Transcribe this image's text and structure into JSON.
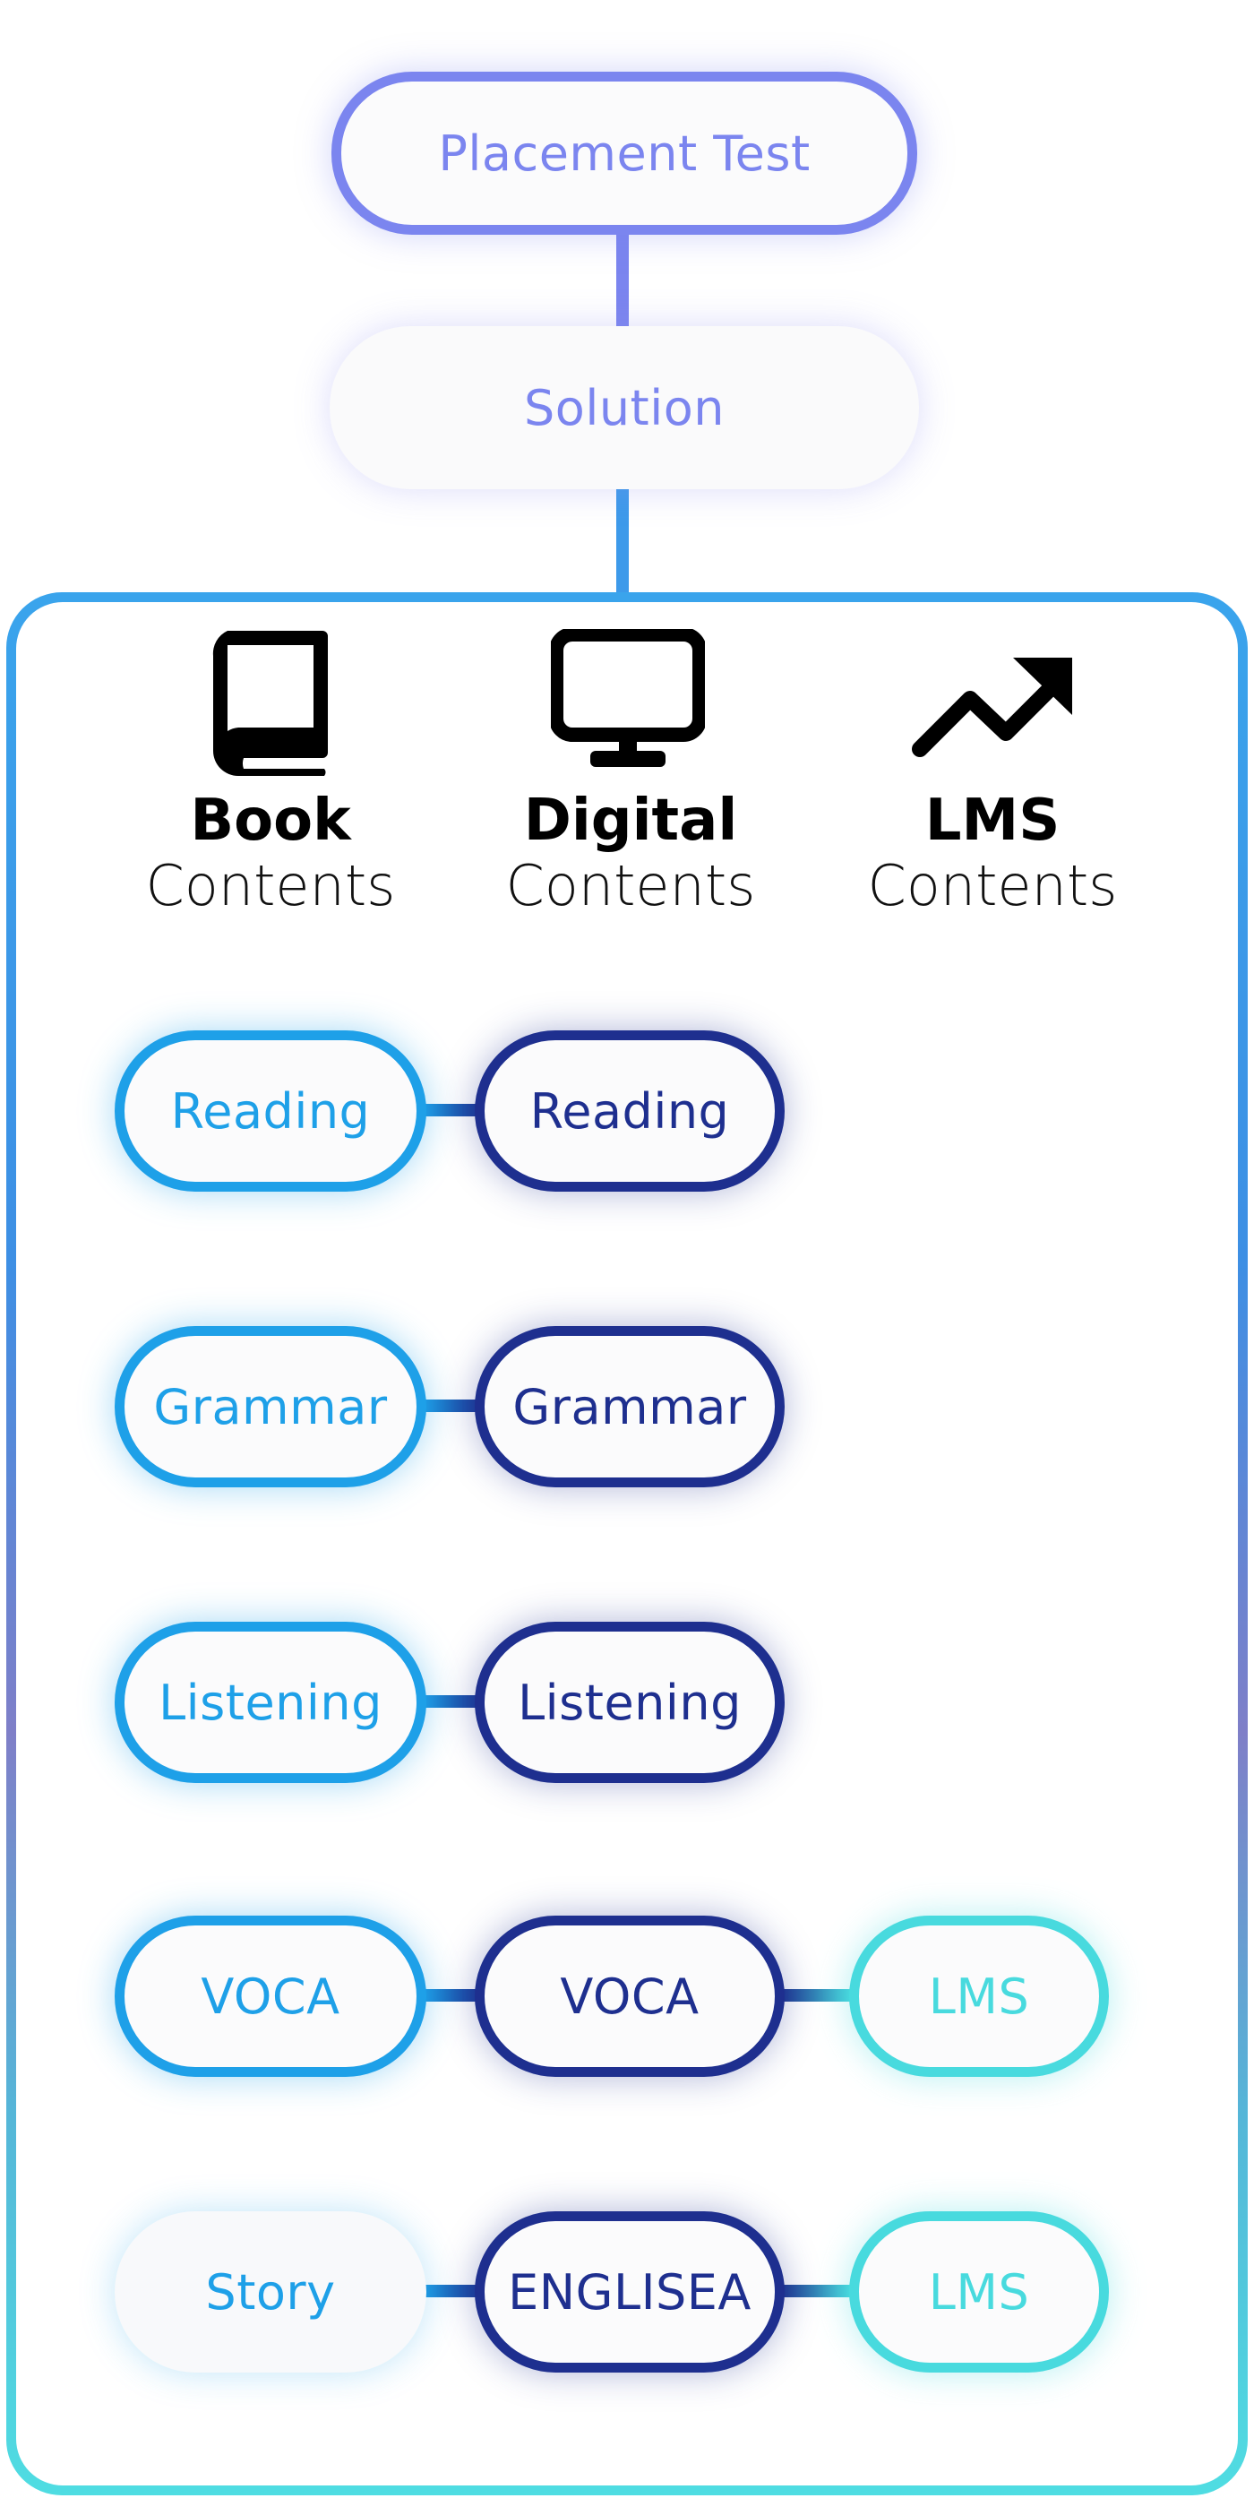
{
  "top": {
    "placement": "Placement Test",
    "solution": "Solution"
  },
  "columns": [
    {
      "icon": "book-icon",
      "title": "Book",
      "subtitle": "Contents"
    },
    {
      "icon": "monitor-icon",
      "title": "Digital",
      "subtitle": "Contents"
    },
    {
      "icon": "trending-up-icon",
      "title": "LMS",
      "subtitle": "Contents"
    }
  ],
  "rows": [
    {
      "book": "Reading",
      "digital": "Reading"
    },
    {
      "book": "Grammar",
      "digital": "Grammar"
    },
    {
      "book": "Listening",
      "digital": "Listening"
    },
    {
      "book": "VOCA",
      "digital": "VOCA",
      "lms": "LMS"
    },
    {
      "book": "Story",
      "digital": "ENGLISEA",
      "lms": "LMS"
    }
  ],
  "colors": {
    "purple": "#7b85ef",
    "book_blue": "#1ea0e8",
    "digital_navy": "#1e2f8f",
    "lms_cyan": "#48dade"
  }
}
